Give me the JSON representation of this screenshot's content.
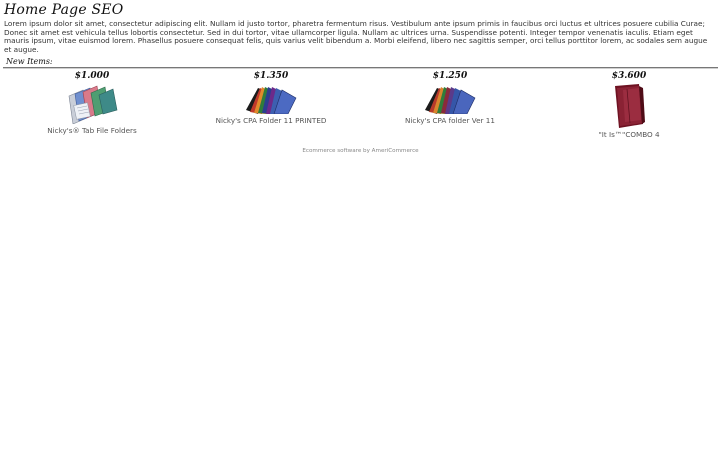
{
  "page": {
    "title": "Home Page SEO",
    "intro": "Lorem ipsum dolor sit amet, consectetur adipiscing elit. Nullam id justo tortor, pharetra fermentum risus. Vestibulum ante ipsum primis in faucibus orci luctus et ultrices posuere cubilia Curae; Donec sit amet est vehicula tellus lobortis consectetur. Sed in dui tortor, vitae ullamcorper ligula. Nullam ac ultrices urna. Suspendisse potenti. Integer tempor venenatis iaculis. Etiam eget mauris ipsum, vitae euismod lorem. Phasellus posuere consequat felis, quis varius velit bibendum a. Morbi eleifend, libero nec sagittis semper, orci tellus porttitor lorem, ac sodales sem augue et augue."
  },
  "new_items": {
    "label": "New Items:",
    "products": [
      {
        "price": "$1.000",
        "name": "Nicky's® Tab File Folders",
        "icon": "tab-file-folders-image"
      },
      {
        "price": "$1.350",
        "name": "Nicky's CPA Folder 11 PRINTED",
        "icon": "cpa-folder-fan-image"
      },
      {
        "price": "$1.250",
        "name": "Nicky's CPA folder Ver 11",
        "icon": "cpa-folder-fan-image"
      },
      {
        "price": "$3.600",
        "name": "\"It Is™\"COMBO 4",
        "icon": "maroon-folder-image"
      }
    ]
  },
  "footer": {
    "text": "Ecommerce software by AmeriCommerce"
  },
  "colors": {
    "divider": "#777777",
    "footer_text": "#888888",
    "maroon_folder": "#7a1a2a"
  }
}
